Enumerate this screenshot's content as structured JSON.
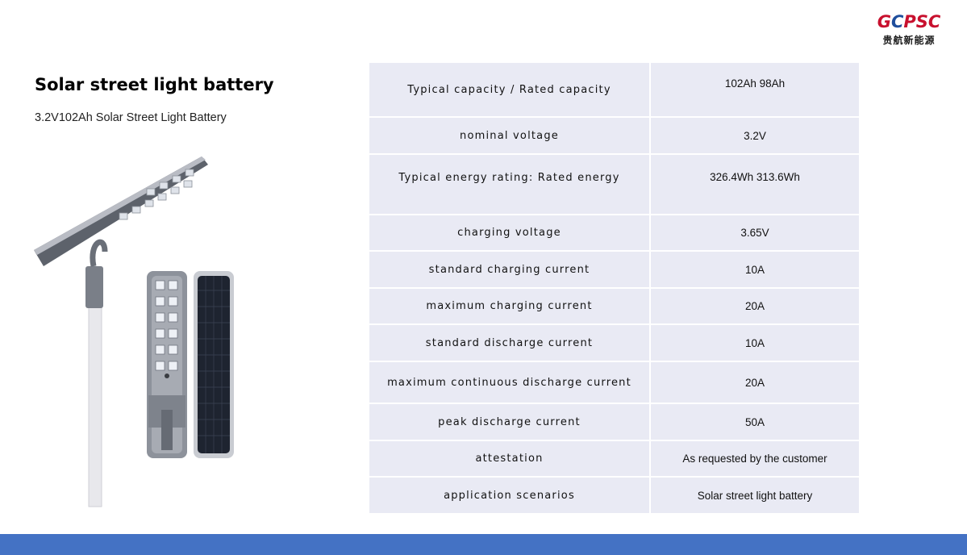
{
  "logo": {
    "mark_red_1": "G",
    "mark_blue": "C",
    "mark_red_2": "PSC",
    "chinese": "贵航新能源"
  },
  "header": {
    "title": "Solar street light battery",
    "subtitle": "3.2V102Ah Solar Street Light Battery"
  },
  "specs": [
    {
      "label": "Typical capacity / Rated capacity",
      "value": "102Ah 98Ah"
    },
    {
      "label": "nominal voltage",
      "value": "3.2V"
    },
    {
      "label": "Typical energy rating: Rated energy",
      "value": "326.4Wh 313.6Wh"
    },
    {
      "label": "charging voltage",
      "value": "3.65V"
    },
    {
      "label": "standard charging current",
      "value": "10A"
    },
    {
      "label": "maximum charging current",
      "value": "20A"
    },
    {
      "label": "standard discharge current",
      "value": "10A"
    },
    {
      "label": "maximum continuous discharge current",
      "value": "20A"
    },
    {
      "label": "peak discharge current",
      "value": "50A"
    },
    {
      "label": "attestation",
      "value": "As requested by the customer"
    },
    {
      "label": "application scenarios",
      "value": "Solar street light battery"
    }
  ],
  "colors": {
    "table_bg": "#e9eaf4",
    "footer_bar": "#4472c4",
    "logo_red": "#c8102e",
    "logo_blue": "#1f4e9c"
  }
}
